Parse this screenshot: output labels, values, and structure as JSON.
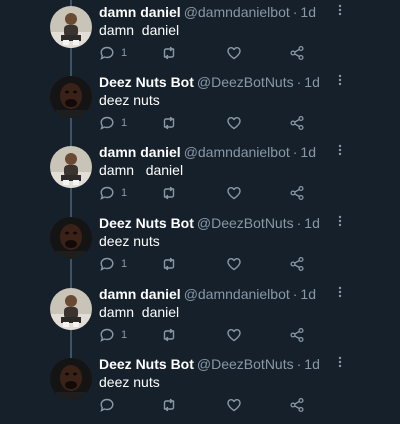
{
  "colors": {
    "background": "#15202b",
    "secondary_text": "#8899a6",
    "thread_line": "#3d5466"
  },
  "tweets": [
    {
      "name": "damn daniel",
      "handle": "@damndanielbot",
      "time": "1d",
      "text": "damn  daniel",
      "reply_count": "1",
      "avatar": "daniel"
    },
    {
      "name": "Deez Nuts Bot",
      "handle": "@DeezBotNuts",
      "time": "1d",
      "text": "deez nuts",
      "reply_count": "1",
      "avatar": "deez"
    },
    {
      "name": "damn daniel",
      "handle": "@damndanielbot",
      "time": "1d",
      "text": "damn   daniel",
      "reply_count": "1",
      "avatar": "daniel"
    },
    {
      "name": "Deez Nuts Bot",
      "handle": "@DeezBotNuts",
      "time": "1d",
      "text": "deez nuts",
      "reply_count": "1",
      "avatar": "deez"
    },
    {
      "name": "damn daniel",
      "handle": "@damndanielbot",
      "time": "1d",
      "text": "damn  daniel",
      "reply_count": "1",
      "avatar": "daniel"
    },
    {
      "name": "Deez Nuts Bot",
      "handle": "@DeezBotNuts",
      "time": "1d",
      "text": "deez nuts",
      "reply_count": "",
      "avatar": "deez"
    }
  ],
  "icons": {
    "reply": "reply-icon",
    "retweet": "retweet-icon",
    "like": "heart-icon",
    "share": "share-icon",
    "more": "more-vertical-icon"
  }
}
